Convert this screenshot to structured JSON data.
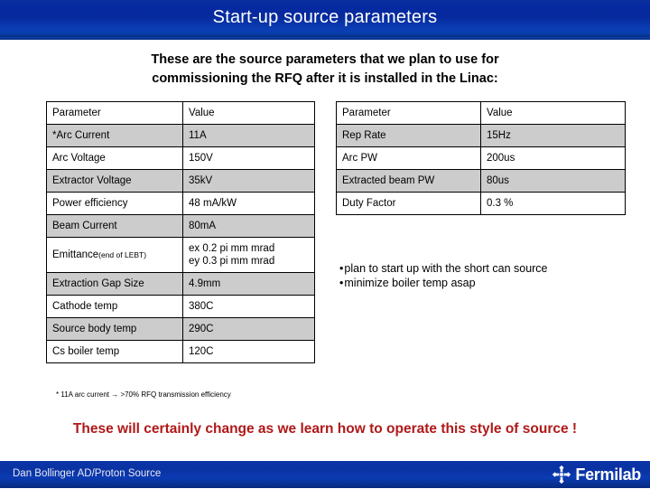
{
  "slide": {
    "title": "Start-up source parameters",
    "subtitle_line1": "These are the source parameters that we plan to use for",
    "subtitle_line2": "commissioning  the RFQ after it is installed in the Linac:",
    "footnote": "* 11A arc current → >70% RFQ transmission efficiency",
    "closing_statement": "These will certainly change as we learn how to operate this style of source !"
  },
  "left_table": {
    "headers": [
      "Parameter",
      "Value"
    ],
    "rows": [
      {
        "parameter": "*Arc Current",
        "value": "11A"
      },
      {
        "parameter": "Arc Voltage",
        "value": "150V"
      },
      {
        "parameter": "Extractor Voltage",
        "value": "35kV"
      },
      {
        "parameter": "Power efficiency",
        "value": "48 mA/kW"
      },
      {
        "parameter": "Beam Current",
        "value": "80mA"
      },
      {
        "parameter": "Emittance",
        "parameter_note": "(end of LEBT)",
        "value_line1": "ex 0.2 pi mm mrad",
        "value_line2": "ey 0.3 pi mm mrad"
      },
      {
        "parameter": "Extraction Gap Size",
        "value": "4.9mm"
      },
      {
        "parameter": "Cathode temp",
        "value": "380C"
      },
      {
        "parameter": "Source body temp",
        "value": "290C"
      },
      {
        "parameter": "Cs boiler temp",
        "value": "120C"
      }
    ]
  },
  "right_table": {
    "headers": [
      "Parameter",
      "Value"
    ],
    "rows": [
      {
        "parameter": "Rep Rate",
        "value": "15Hz"
      },
      {
        "parameter": "Arc PW",
        "value": "200us"
      },
      {
        "parameter": "Extracted beam PW",
        "value": "80us"
      },
      {
        "parameter": "Duty Factor",
        "value": "0.3 %"
      }
    ]
  },
  "bullets": [
    "plan to start up with the short can source",
    "minimize boiler temp asap"
  ],
  "footer": {
    "author": "Dan Bollinger AD/Proton Source",
    "brand": "Fermilab"
  },
  "colors": {
    "header_blue": "#0529a0",
    "shaded_row": "#cccccc",
    "red_text": "#b01818"
  }
}
